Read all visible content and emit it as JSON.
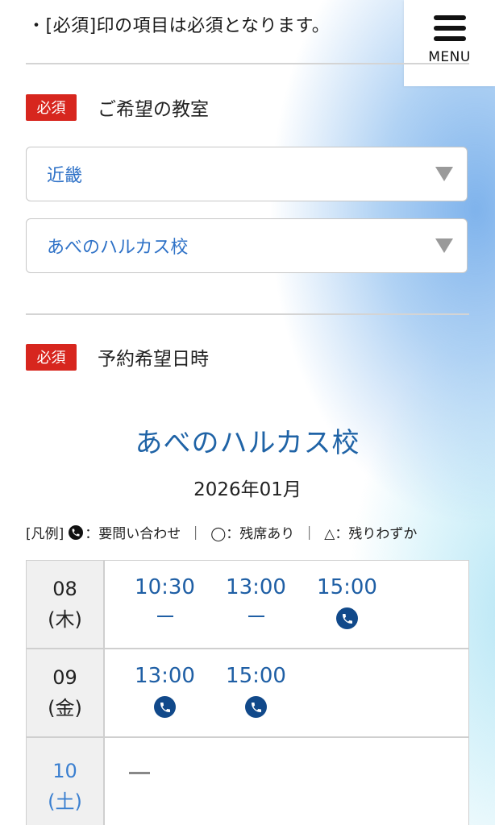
{
  "notice": "・[必須]印の項目は必須となります。",
  "menu": {
    "label": "MENU"
  },
  "classroom_field": {
    "required_badge": "必須",
    "label": "ご希望の教室",
    "region_select": "近畿",
    "school_select": "あべのハルカス校"
  },
  "datetime_field": {
    "required_badge": "必須",
    "label": "予約希望日時"
  },
  "calendar": {
    "school_name": "あべのハルカス校",
    "month": "2026年01月",
    "legend": {
      "prefix": "[凡例]",
      "phone_text": "：要問い合わせ",
      "sep1": "｜",
      "circle_text": "◯：残席あり",
      "sep2": "｜",
      "triangle_text": "△：残りわずか"
    },
    "rows": [
      {
        "day": "08",
        "weekday": "(木)",
        "slots": [
          {
            "time": "10:30",
            "status": "dash"
          },
          {
            "time": "13:00",
            "status": "dash"
          },
          {
            "time": "15:00",
            "status": "phone"
          }
        ]
      },
      {
        "day": "09",
        "weekday": "(金)",
        "slots": [
          {
            "time": "13:00",
            "status": "phone"
          },
          {
            "time": "15:00",
            "status": "phone"
          }
        ]
      },
      {
        "day": "10",
        "weekday": "(土)",
        "slots": []
      }
    ]
  },
  "colors": {
    "required_badge": "#d7261e",
    "accent_blue": "#1f63a6",
    "select_text": "#2f72c7",
    "saturday": "#3a7fd0",
    "phone_icon": "#11498a"
  },
  "icons": {
    "menu": "hamburger-icon",
    "select_arrow": "triangle-down-icon",
    "phone": "phone-icon"
  }
}
